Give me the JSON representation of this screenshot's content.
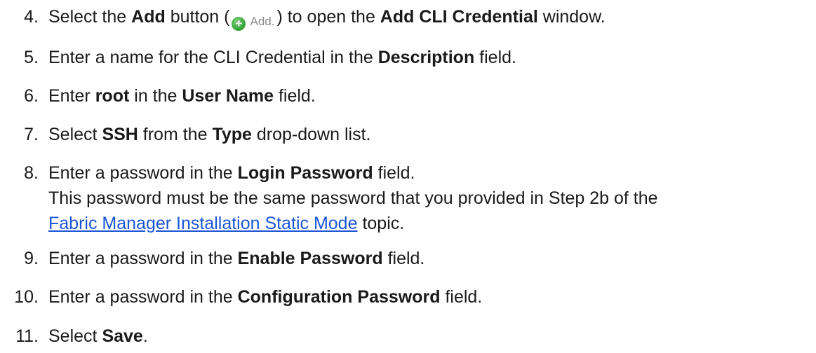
{
  "steps": [
    {
      "num": "4.",
      "before": "Select the ",
      "b1": "Add",
      "mid1": " button (",
      "icon_label": "Add.",
      "mid2": ") to open the ",
      "b2": "Add CLI Credential",
      "after": " window."
    },
    {
      "num": "5.",
      "before": "Enter a name for the CLI Credential in the ",
      "b1": "Description",
      "after": " field."
    },
    {
      "num": "6.",
      "before": "Enter ",
      "b1": "root",
      "mid1": " in the ",
      "b2": "User Name",
      "after": " field."
    },
    {
      "num": "7.",
      "before": "Select ",
      "b1": "SSH",
      "mid1": " from the ",
      "b2": "Type",
      "after": " drop-down list."
    },
    {
      "num": "8.",
      "before": "Enter a password in the ",
      "b1": "Login Password",
      "after": " field.",
      "line2": "This password must be the same password that you provided in Step 2b of the",
      "link": "Fabric Manager Installation Static Mode",
      "line3_after": " topic."
    },
    {
      "num": "9.",
      "before": "Enter a password in the ",
      "b1": "Enable Password",
      "after": " field."
    },
    {
      "num": "10.",
      "before": "Enter a password in the ",
      "b1": "Configuration Password",
      "after": " field."
    },
    {
      "num": "11.",
      "before": "Select ",
      "b1": "Save",
      "after": "."
    }
  ],
  "icons": {
    "add": "add-plus-icon",
    "add_color": "#3aa63a"
  },
  "link_color": "#1a55d6"
}
